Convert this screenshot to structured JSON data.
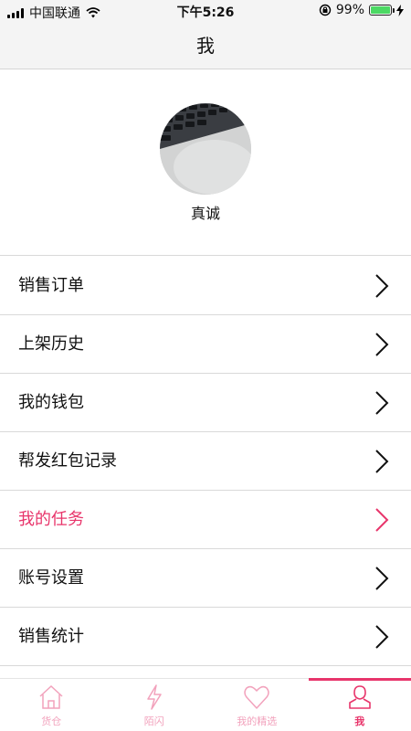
{
  "status_bar": {
    "carrier": "中国联通",
    "time": "下午5:26",
    "battery": "99%",
    "battery_level": 0.99
  },
  "nav": {
    "title": "我"
  },
  "profile": {
    "username": "真诚"
  },
  "menu": {
    "items": [
      {
        "label": "销售订单"
      },
      {
        "label": "上架历史"
      },
      {
        "label": "我的钱包"
      },
      {
        "label": "帮发红包记录"
      },
      {
        "label": "我的任务",
        "highlighted": true
      },
      {
        "label": "账号设置"
      },
      {
        "label": "销售统计"
      }
    ]
  },
  "tabs": [
    {
      "label": "货仓",
      "icon": "home-icon"
    },
    {
      "label": "陌闪",
      "icon": "lightning-icon"
    },
    {
      "label": "我的精选",
      "icon": "heart-icon"
    },
    {
      "label": "我",
      "icon": "person-icon",
      "active": true
    }
  ],
  "colors": {
    "accent": "#e8356b",
    "accent_light": "#f2a2bc",
    "battery": "#4cd964"
  }
}
